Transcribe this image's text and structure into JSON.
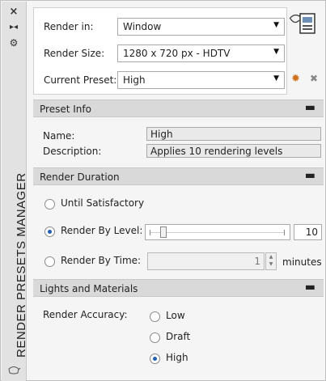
{
  "palette": {
    "title": "RENDER PRESETS MANAGER",
    "close_icon": "×",
    "autohide_icon": "▸◂",
    "properties_icon": "⚙",
    "bottom_icon": "teapot-icon"
  },
  "top": {
    "render_in": {
      "label": "Render in:",
      "value": "Window"
    },
    "render_size": {
      "label": "Render Size:",
      "value": "1280 x 720 px - HDTV"
    },
    "current_preset": {
      "label": "Current Preset:",
      "value": "High"
    },
    "render_icon": "render-window-icon",
    "create_copy_icon": "gear-icon",
    "delete_icon": "delete-icon"
  },
  "preset_info": {
    "title": "Preset Info",
    "collapse": "▬",
    "name_label": "Name:",
    "name_value": "High",
    "description_label": "Description:",
    "description_value": "Applies 10 rendering levels"
  },
  "render_duration": {
    "title": "Render Duration",
    "collapse": "▬",
    "options": [
      {
        "label": "Until Satisfactory",
        "checked": false
      },
      {
        "label": "Render By Level:",
        "checked": true
      },
      {
        "label": "Render By Time:",
        "checked": false
      }
    ],
    "level_value": "10",
    "time_value": "1",
    "time_unit": "minutes"
  },
  "lights_materials": {
    "title": "Lights and Materials",
    "collapse": "▬",
    "accuracy_label": "Render Accuracy:",
    "options": [
      {
        "label": "Low",
        "checked": false
      },
      {
        "label": "Draft",
        "checked": false
      },
      {
        "label": "High",
        "checked": true
      }
    ]
  },
  "colors": {
    "radio_selected": "#1e5fb4",
    "section_header": "#d9d9d9",
    "preset_gear": "#d0701a"
  }
}
